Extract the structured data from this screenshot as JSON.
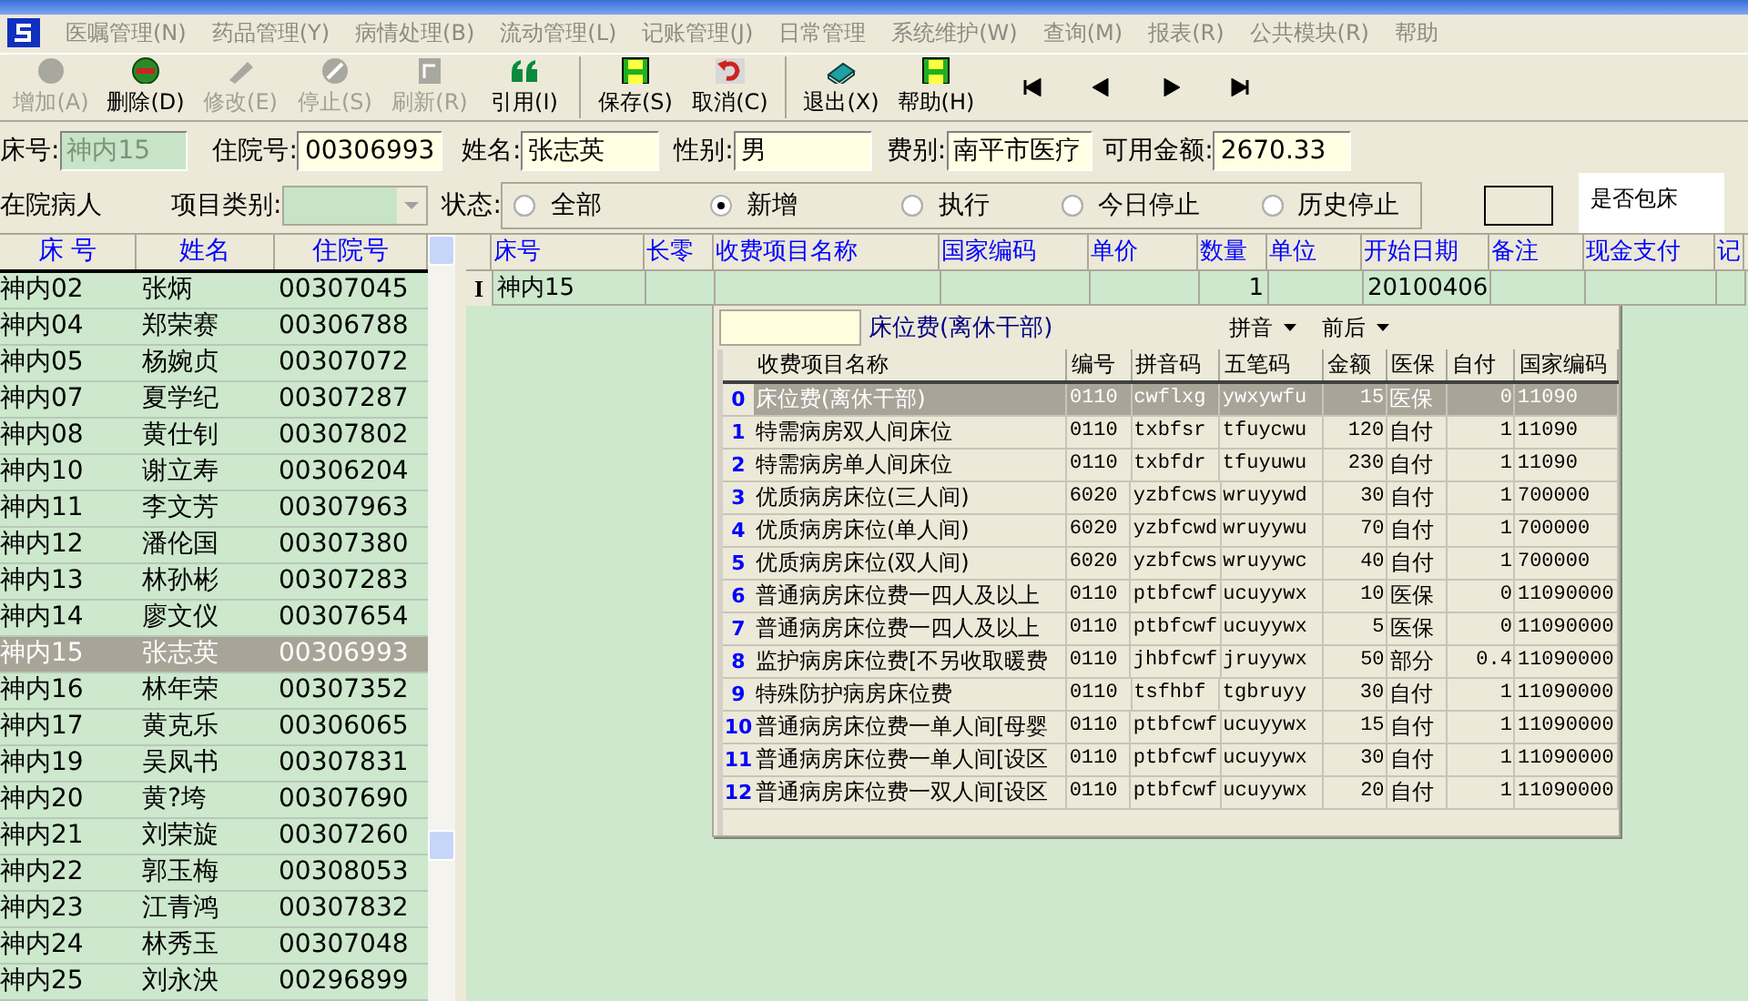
{
  "menu": [
    {
      "label": "医嘱管理(N)"
    },
    {
      "label": "药品管理(Y)"
    },
    {
      "label": "病情处理(B)"
    },
    {
      "label": "流动管理(L)"
    },
    {
      "label": "记账管理(J)"
    },
    {
      "label": "日常管理"
    },
    {
      "label": "系统维护(W)"
    },
    {
      "label": "查询(M)"
    },
    {
      "label": "报表(R)"
    },
    {
      "label": "公共模块(R)"
    },
    {
      "label": "帮助"
    }
  ],
  "toolbar_groups": [
    {
      "buttons": [
        {
          "label": "增加(A)",
          "disabled": true
        },
        {
          "label": "删除(D)",
          "disabled": false
        },
        {
          "label": "修改(E)",
          "disabled": true
        },
        {
          "label": "停止(S)",
          "disabled": true
        },
        {
          "label": "刷新(R)",
          "disabled": true
        },
        {
          "label": "引用(I)",
          "disabled": false
        }
      ]
    },
    {
      "buttons": [
        {
          "label": "保存(S)",
          "disabled": false
        },
        {
          "label": "取消(C)",
          "disabled": false
        }
      ]
    },
    {
      "buttons": [
        {
          "label": "退出(X)",
          "disabled": false
        },
        {
          "label": "帮助(H)",
          "disabled": false
        }
      ]
    }
  ],
  "patient_fields": [
    {
      "label": "床号:",
      "value": "神内15",
      "disabled": true
    },
    {
      "label": "住院号:",
      "value": "00306993",
      "disabled": false
    },
    {
      "label": "姓名:",
      "value": "张志英",
      "disabled": false
    },
    {
      "label": "性别:",
      "value": "男",
      "disabled": false
    },
    {
      "label": "费别:",
      "value": "南平市医疗",
      "disabled": false
    },
    {
      "label": "可用金额:",
      "value": "2670.33",
      "disabled": false
    }
  ],
  "filter": {
    "title": "在院病人",
    "category_label": "项目类别:",
    "status_label": "状态:",
    "status_options": [
      {
        "label": "全部",
        "selected": false
      },
      {
        "label": "新增",
        "selected": true
      },
      {
        "label": "执行",
        "selected": false
      },
      {
        "label": "今日停止",
        "selected": false
      },
      {
        "label": "历史停止",
        "selected": false
      }
    ],
    "bed_pack_label": "是否包床"
  },
  "patients": {
    "columns": [
      "床 号",
      "姓名",
      "住院号"
    ],
    "rows": [
      {
        "bed": "神内02",
        "name": "张炳",
        "id": "00307045",
        "selected": false
      },
      {
        "bed": "神内04",
        "name": "郑荣赛",
        "id": "00306788",
        "selected": false
      },
      {
        "bed": "神内05",
        "name": "杨婉贞",
        "id": "00307072",
        "selected": false
      },
      {
        "bed": "神内07",
        "name": "夏学纪",
        "id": "00307287",
        "selected": false
      },
      {
        "bed": "神内08",
        "name": "黄仕钊",
        "id": "00307802",
        "selected": false
      },
      {
        "bed": "神内10",
        "name": "谢立寿",
        "id": "00306204",
        "selected": false
      },
      {
        "bed": "神内11",
        "name": "李文芳",
        "id": "00307963",
        "selected": false
      },
      {
        "bed": "神内12",
        "name": "潘伦国",
        "id": "00307380",
        "selected": false
      },
      {
        "bed": "神内13",
        "name": "林孙彬",
        "id": "00307283",
        "selected": false
      },
      {
        "bed": "神内14",
        "name": "廖文仪",
        "id": "00307654",
        "selected": false
      },
      {
        "bed": "神内15",
        "name": "张志英",
        "id": "00306993",
        "selected": true
      },
      {
        "bed": "神内16",
        "name": "林年荣",
        "id": "00307352",
        "selected": false
      },
      {
        "bed": "神内17",
        "name": "黄克乐",
        "id": "00306065",
        "selected": false
      },
      {
        "bed": "神内19",
        "name": "吴凤书",
        "id": "00307831",
        "selected": false
      },
      {
        "bed": "神内20",
        "name": "黄?垮",
        "id": "00307690",
        "selected": false
      },
      {
        "bed": "神内21",
        "name": "刘荣旋",
        "id": "00307260",
        "selected": false
      },
      {
        "bed": "神内22",
        "name": "郭玉梅",
        "id": "00308053",
        "selected": false
      },
      {
        "bed": "神内23",
        "name": "江青鸿",
        "id": "00307832",
        "selected": false
      },
      {
        "bed": "神内24",
        "name": "林秀玉",
        "id": "00307048",
        "selected": false
      },
      {
        "bed": "神内25",
        "name": "刘永泱",
        "id": "00296899",
        "selected": false
      }
    ]
  },
  "orders": {
    "row_marker": "I",
    "columns": [
      "床号",
      "长零",
      "收费项目名称",
      "国家编码",
      "单价",
      "数量",
      "单位",
      "开始日期",
      "备注",
      "现金支付",
      "记"
    ],
    "rows": [
      [
        "神内15",
        "",
        "",
        "",
        "",
        "1",
        "",
        "20100406",
        "",
        "",
        ""
      ]
    ]
  },
  "item_picker": {
    "current_item": "床位费(离休干部)",
    "sort_options": [
      {
        "label": "拼音"
      },
      {
        "label": "前后"
      }
    ],
    "columns": [
      "收费项目名称",
      "编号",
      "拼音码",
      "五笔码",
      "金额",
      "医保",
      "自付",
      "国家编码"
    ],
    "rows": [
      {
        "index": "0",
        "cells": [
          "床位费(离休干部)",
          "0110",
          "cwflxg",
          "ywxywfu",
          "15",
          "医保",
          "0",
          "11090"
        ],
        "selected": true
      },
      {
        "index": "1",
        "cells": [
          "特需病房双人间床位",
          "0110",
          "txbfsr",
          "tfuycwu",
          "120",
          "自付",
          "1",
          "11090"
        ],
        "selected": false
      },
      {
        "index": "2",
        "cells": [
          "特需病房单人间床位",
          "0110",
          "txbfdr",
          "tfuyuwu",
          "230",
          "自付",
          "1",
          "11090"
        ],
        "selected": false
      },
      {
        "index": "3",
        "cells": [
          "优质病房床位(三人间)",
          "6020",
          "yzbfcws",
          "wruyywd",
          "30",
          "自付",
          "1",
          "700000"
        ],
        "selected": false
      },
      {
        "index": "4",
        "cells": [
          "优质病房床位(单人间)",
          "6020",
          "yzbfcwd",
          "wruyywu",
          "70",
          "自付",
          "1",
          "700000"
        ],
        "selected": false
      },
      {
        "index": "5",
        "cells": [
          "优质病房床位(双人间)",
          "6020",
          "yzbfcws",
          "wruyywc",
          "40",
          "自付",
          "1",
          "700000"
        ],
        "selected": false
      },
      {
        "index": "6",
        "cells": [
          "普通病房床位费一四人及以上",
          "0110",
          "ptbfcwf",
          "ucuyywx",
          "10",
          "医保",
          "0",
          "11090000"
        ],
        "selected": false
      },
      {
        "index": "7",
        "cells": [
          "普通病房床位费一四人及以上",
          "0110",
          "ptbfcwf",
          "ucuyywx",
          "5",
          "医保",
          "0",
          "11090000"
        ],
        "selected": false
      },
      {
        "index": "8",
        "cells": [
          "监护病房床位费[不另收取暖费",
          "0110",
          "jhbfcwf",
          "jruyywx",
          "50",
          "部分",
          "0.4",
          "11090000"
        ],
        "selected": false
      },
      {
        "index": "9",
        "cells": [
          "特殊防护病房床位费",
          "0110",
          "tsfhbf",
          "tgbruyy",
          "30",
          "自付",
          "1",
          "11090000"
        ],
        "selected": false
      },
      {
        "index": "10",
        "cells": [
          "普通病房床位费一单人间[母婴",
          "0110",
          "ptbfcwf",
          "ucuyywx",
          "15",
          "自付",
          "1",
          "11090000"
        ],
        "selected": false
      },
      {
        "index": "11",
        "cells": [
          "普通病房床位费一单人间[设区",
          "0110",
          "ptbfcwf",
          "ucuyywx",
          "30",
          "自付",
          "1",
          "11090000"
        ],
        "selected": false
      },
      {
        "index": "12",
        "cells": [
          "普通病房床位费一双人间[设区",
          "0110",
          "ptbfcwf",
          "ucuyywx",
          "20",
          "自付",
          "1",
          "11090000"
        ],
        "selected": false
      }
    ]
  }
}
